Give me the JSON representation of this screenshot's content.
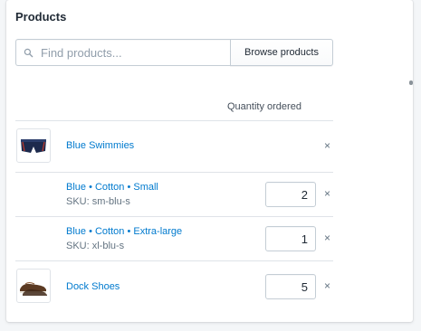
{
  "title": "Products",
  "search": {
    "placeholder": "Find products...",
    "value": "",
    "browse_label": "Browse products"
  },
  "table": {
    "quantity_header": "Quantity ordered"
  },
  "products": [
    {
      "name": "Blue Swimmies",
      "image": "swim-shorts-thumbnail",
      "remove_label": "×",
      "variants": [
        {
          "title": "Blue • Cotton • Small",
          "sku": "SKU: sm-blu-s",
          "quantity": "2",
          "remove_label": "×"
        },
        {
          "title": "Blue • Cotton • Extra-large",
          "sku": "SKU: xl-blu-s",
          "quantity": "1",
          "remove_label": "×"
        }
      ]
    },
    {
      "name": "Dock Shoes",
      "image": "dock-shoes-thumbnail",
      "quantity": "5",
      "remove_label": "×"
    }
  ],
  "colors": {
    "link": "#007ace",
    "border": "#c4cdd5",
    "divider": "#dfe3e8"
  }
}
